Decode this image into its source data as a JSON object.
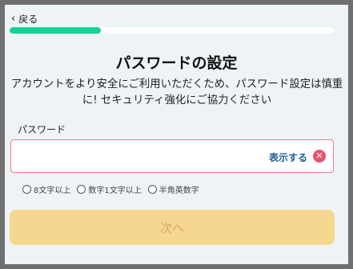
{
  "header": {
    "back_label": "戻る",
    "progress_fraction": 0.28
  },
  "main": {
    "title": "パスワードの設定",
    "description": "アカウントをより安全にご利用いただくため、パスワード設定は慎重に! セキュリティ強化にご協力ください",
    "password_label": "パスワード",
    "password_value": "",
    "show_toggle_label": "表示する",
    "rules": [
      {
        "label": "8文字以上"
      },
      {
        "label": "数字1文字以上"
      },
      {
        "label": "半角英数字"
      }
    ],
    "next_button_label": "次へ"
  },
  "colors": {
    "accent_progress": "#12d29a",
    "error_border": "#f07a8a",
    "link": "#1a5d9a",
    "button_disabled": "#f6d78f"
  },
  "icons": {
    "back": "chevron-left-icon",
    "clear": "close-icon"
  }
}
